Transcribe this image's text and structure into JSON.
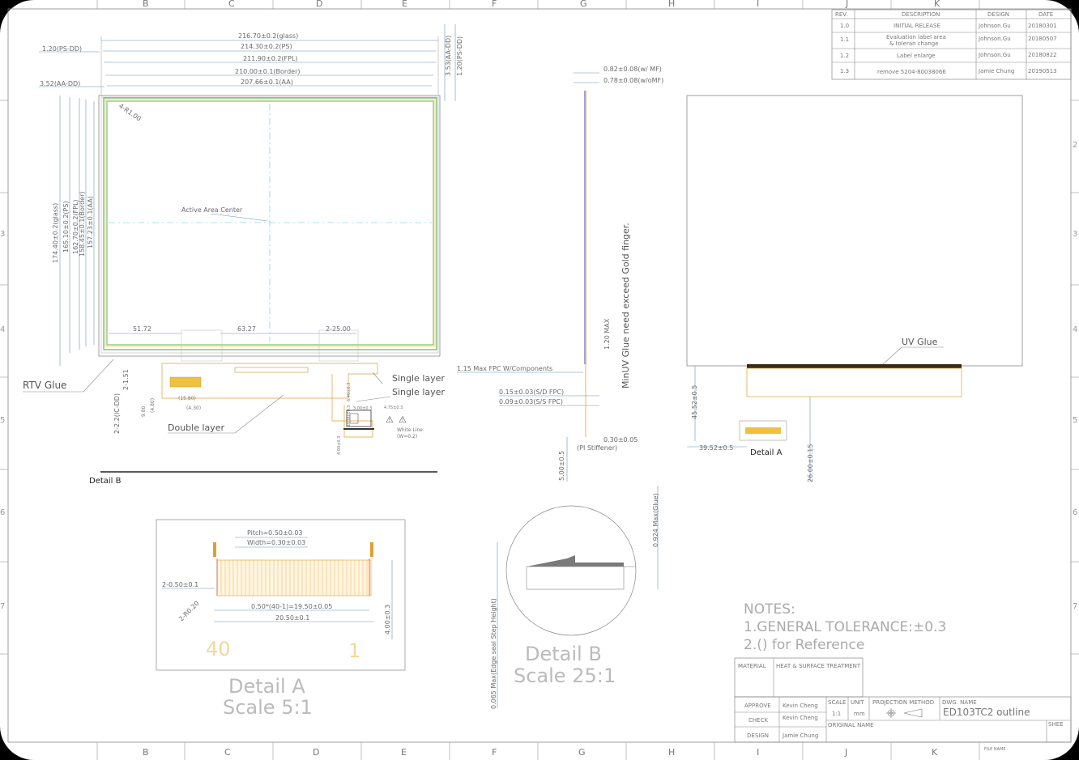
{
  "grid": {
    "columns": [
      "B",
      "C",
      "D",
      "E",
      "F",
      "G",
      "H",
      "I",
      "J",
      "K"
    ],
    "rows": [
      "2",
      "3",
      "4",
      "5",
      "6",
      "7"
    ]
  },
  "revision_table": {
    "headers": [
      "REV.",
      "DESCRIPTION",
      "DESIGN",
      "DATE"
    ],
    "rows": [
      {
        "rev": "1.0",
        "desc": "INITIAL RELEASE",
        "design": "Johnson.Gu",
        "date": "20180301"
      },
      {
        "rev": "1.1",
        "desc": "Evaluation label area",
        "desc2": "& toleran change",
        "design": "Johnson.Gu",
        "date": "20180507"
      },
      {
        "rev": "1.2",
        "desc": "Label enlarge",
        "design": "Johnson.Gu",
        "date": "20180822"
      },
      {
        "rev": "1.3",
        "desc": "remove 5204-80038066",
        "design": "Jamie Chung",
        "date": "20190513"
      }
    ]
  },
  "front_view": {
    "dims_horizontal": [
      "216.70±0.2(glass)",
      "214.30±0.2(PS)",
      "211.90±0.2(FPL)",
      "210.00±0.1(Border)",
      "207.66±0.1(AA)"
    ],
    "left_notes": [
      "1.20(PS-DD)",
      "3.52(AA-DD)"
    ],
    "right_notes": [
      "3.53(AA-DD)",
      "1.20(PS-DD)"
    ],
    "corner": "4-R1.00",
    "dims_vertical": [
      "174.40±0.2(glass)",
      "165.10±0.2(PS)",
      "162.70±0.2(FPL)",
      "158.45±0.1(Border)",
      "157.23±0.1(AA)"
    ],
    "active_area": "Active Area Center",
    "bottom_dims": [
      "51.72",
      "63.27",
      "2-25.00"
    ],
    "rtv": "RTV Glue",
    "small_dims": [
      "2-1.51",
      "2-2.2(IC-DD)",
      "(15.80)",
      "(4.30)",
      "(4.80)",
      "9.80",
      "6.40±0.3",
      "3.00±0.3",
      "10.00±0.3",
      "4.00±0.3",
      "4.75±0.3"
    ],
    "layers": [
      "Single layer",
      "Single layer",
      "Double layer"
    ],
    "white_line": "White Line",
    "white_line2": "(W=0.2)",
    "detail_b": "Detail B"
  },
  "side_view": {
    "dims": [
      "0.82±0.08(w/ MF)",
      "0.78±0.08(w/oMF)",
      "1.20 MAX",
      "1.15 Max FPC W/Components",
      "0.15±0.03(S/D FPC)",
      "0.09±0.03(S/S FPC)",
      "0.30±0.05",
      "(PI Stiffener)",
      "5.00±0.5"
    ],
    "note": "MinUV Glue need exceed Gold finger."
  },
  "back_view": {
    "uv_glue": "UV Glue",
    "dims": [
      "45.52±0.5",
      "39.52±0.5",
      "26.00±0.15"
    ],
    "detail_a": "Detail A"
  },
  "detail_a": {
    "dims": [
      "Pitch=0.50±0.03",
      "Width=0.30±0.03",
      "2-0.50±0.1",
      "2-R0.20",
      "0.50*(40-1)=19.50±0.05",
      "20.50±0.1",
      "4.00±0.3"
    ],
    "pins": [
      "40",
      "1"
    ],
    "title": "Detail A",
    "scale": "Scale 5:1"
  },
  "detail_b": {
    "dims": [
      "0.924 Max(Glue)",
      "0.065 Max(Edge seal Step Height)"
    ],
    "title": "Detail B",
    "scale": "Scale 25:1"
  },
  "notes": {
    "title": "NOTES:",
    "lines": [
      "1.GENERAL TOLERANCE:±0.3",
      "2.() for Reference"
    ]
  },
  "title_block": {
    "material": "MATERIAL",
    "heat": "HEAT & SURFACE TREATMENT",
    "approve": "APPROVE",
    "check": "CHECK",
    "design": "DESIGN",
    "approve_name": "Kevin Cheng",
    "check_name": "Kevin Cheng",
    "design_name": "Jamie Chung",
    "scale_label": "SCALE",
    "scale_value": "1:1",
    "unit_label": "UNIT",
    "unit_value": "mm",
    "projection": "PROJECTION METHOD",
    "dwg_label": "DWG. NAME",
    "dwg_name": "ED103TC2 outline",
    "orig_label": "ORIGINAL NAME",
    "sheet": "SHEE",
    "file_name": "FILE NAME :"
  }
}
